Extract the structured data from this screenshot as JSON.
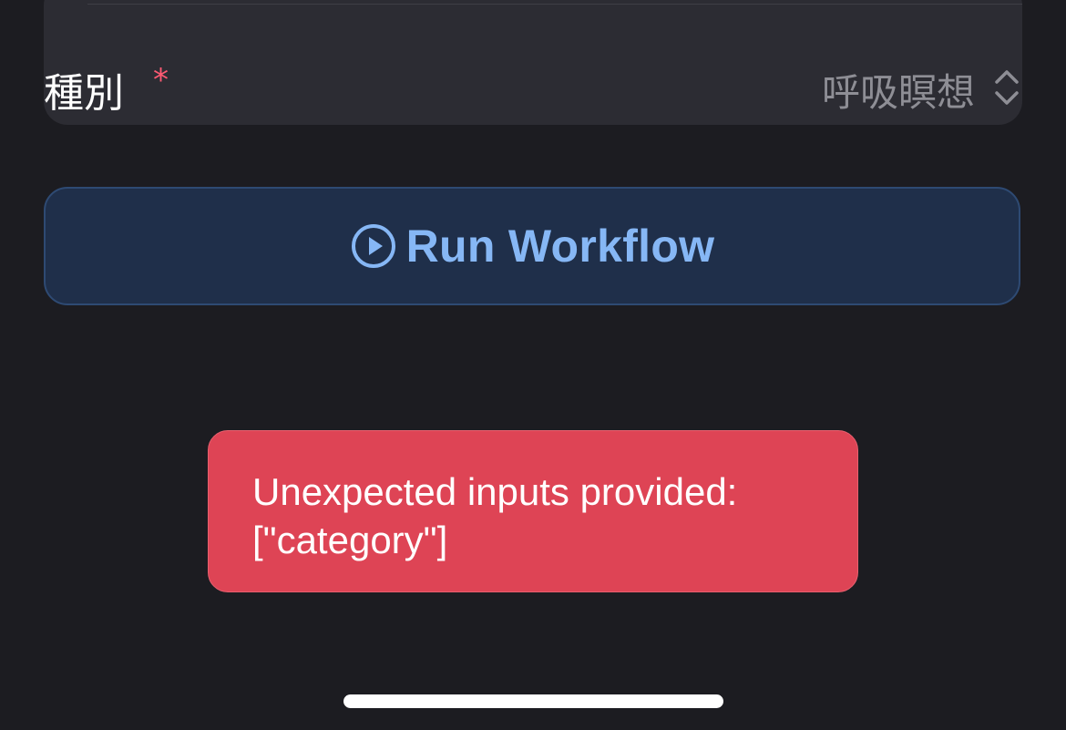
{
  "form": {
    "field_label": "種別",
    "required_mark": "*",
    "selected_value": "呼吸瞑想"
  },
  "run_button": {
    "label": "Run Workflow",
    "icon": "play-circle-icon"
  },
  "error_toast": {
    "line1": "Unexpected inputs provided:",
    "line2": "[\"category\"]"
  },
  "colors": {
    "background": "#1c1c21",
    "card": "#2c2c33",
    "required": "#ff5a73",
    "button_bg": "#1f2f4a",
    "button_text": "#86b7f5",
    "error_bg": "#de4455"
  }
}
